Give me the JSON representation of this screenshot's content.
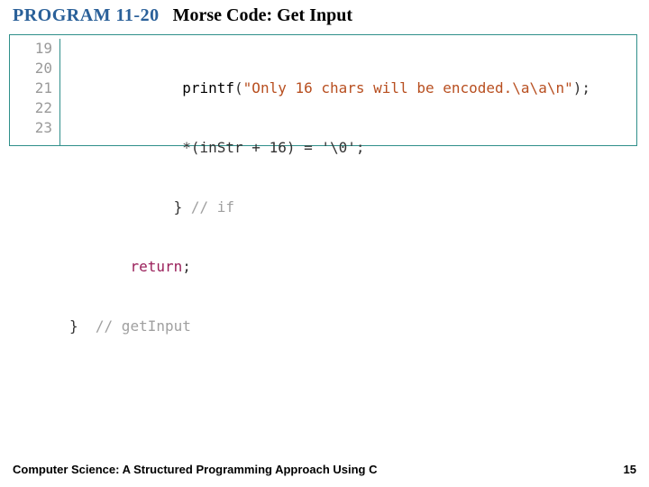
{
  "heading": {
    "program_label": "PROGRAM 11-20",
    "program_title": "Morse Code: Get Input"
  },
  "code": {
    "lines": [
      {
        "num": "19",
        "indent": "             ",
        "segments": [
          {
            "cls": "tok-func",
            "text": "printf"
          },
          {
            "cls": "tok-text",
            "text": "("
          },
          {
            "cls": "tok-str",
            "text": "\"Only 16 chars will be encoded.\\a\\a\\n\""
          },
          {
            "cls": "tok-text",
            "text": ");"
          }
        ]
      },
      {
        "num": "20",
        "indent": "             ",
        "segments": [
          {
            "cls": "tok-text",
            "text": "*(inStr + 16) = '\\0';"
          }
        ]
      },
      {
        "num": "21",
        "indent": "            ",
        "segments": [
          {
            "cls": "tok-text",
            "text": "} "
          },
          {
            "cls": "tok-comm",
            "text": "// if"
          }
        ]
      },
      {
        "num": "22",
        "indent": "       ",
        "segments": [
          {
            "cls": "tok-kw",
            "text": "return"
          },
          {
            "cls": "tok-text",
            "text": ";"
          }
        ]
      },
      {
        "num": "23",
        "indent": "",
        "segments": [
          {
            "cls": "tok-text",
            "text": "}  "
          },
          {
            "cls": "tok-comm",
            "text": "// getInput"
          }
        ]
      }
    ]
  },
  "footer": {
    "book": "Computer Science: A Structured Programming Approach Using C",
    "page": "15"
  }
}
